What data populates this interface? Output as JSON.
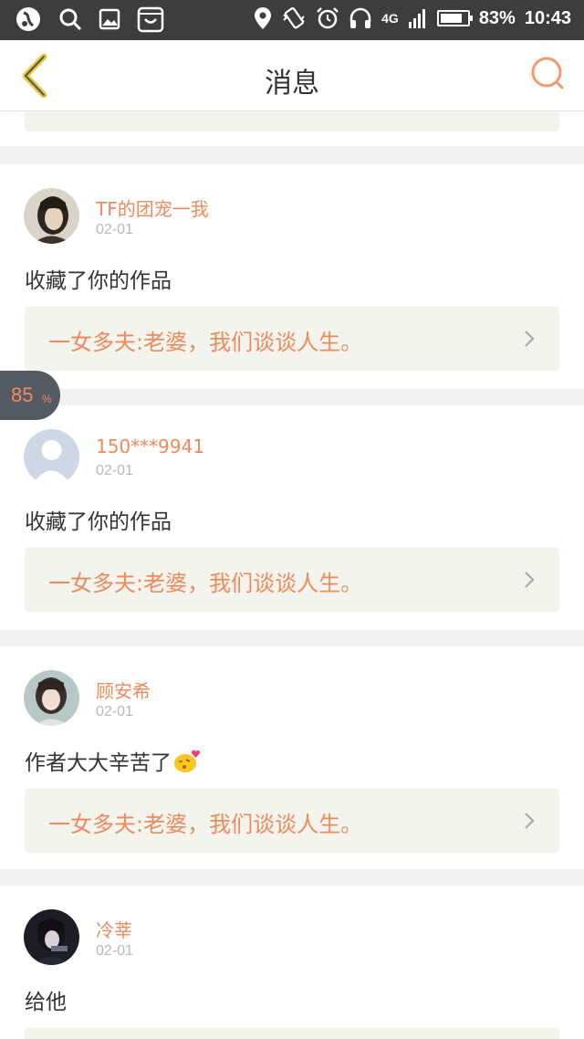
{
  "status_bar": {
    "network": "4G",
    "battery_percent": "83%",
    "battery_level": 0.83,
    "time": "10:43",
    "left_icons": [
      "app-logo-icon",
      "search-icon",
      "image-icon",
      "shop-bag-icon"
    ],
    "right_icons": [
      "location-icon",
      "vibrate-icon",
      "alarm-icon",
      "headphones-icon",
      "signal-icon",
      "battery-icon"
    ]
  },
  "navbar": {
    "title": "消息",
    "back_icon": "chevron-left-icon",
    "search_icon": "search-icon"
  },
  "messages": [
    {
      "username": "TF的团宠一我",
      "date": "02-01",
      "action": "收藏了你的作品",
      "work_title": "一女多夫:老婆，我们谈谈人生。"
    },
    {
      "username": "150***9941",
      "date": "02-01",
      "action": "收藏了你的作品",
      "work_title": "一女多夫:老婆，我们谈谈人生。"
    },
    {
      "username": "顾安希",
      "date": "02-01",
      "action": "作者大大辛苦了",
      "action_emoji": "kiss-emoji-icon",
      "work_title": "一女多夫:老婆，我们谈谈人生。"
    },
    {
      "username": "冷莘",
      "date": "02-01",
      "action": "给他"
    }
  ],
  "floating_badge": {
    "value": "85",
    "unit": "%"
  },
  "colors": {
    "accent": "#ef8a5a",
    "status_bar": "#3d3d3d",
    "work_box": "#f4f4ef"
  }
}
